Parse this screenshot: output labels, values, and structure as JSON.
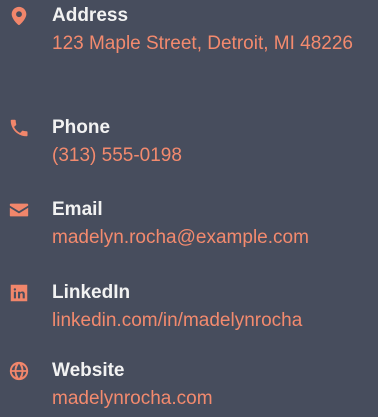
{
  "contact": {
    "items": [
      {
        "key": "address",
        "label": "Address",
        "value": "123 Maple Street, Detroit, MI 48226",
        "icon": "map-pin-icon"
      },
      {
        "key": "phone",
        "label": "Phone",
        "value": "(313) 555-0198",
        "icon": "phone-icon"
      },
      {
        "key": "email",
        "label": "Email",
        "value": "madelyn.rocha@example.com",
        "icon": "envelope-icon"
      },
      {
        "key": "linkedin",
        "label": "LinkedIn",
        "value": "linkedin.com/in/madelynrocha",
        "icon": "linkedin-icon"
      },
      {
        "key": "website",
        "label": "Website",
        "value": "madelynrocha.com",
        "icon": "globe-icon"
      }
    ]
  },
  "colors": {
    "background": "#474d5d",
    "accent": "#f1866b",
    "label": "#f2f2f2"
  }
}
